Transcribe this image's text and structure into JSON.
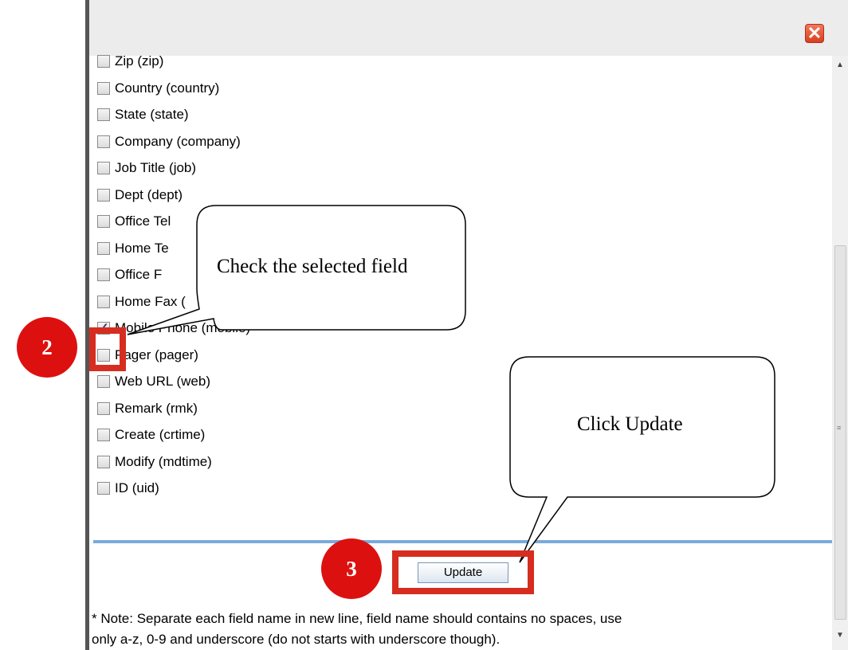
{
  "dialog": {
    "close_glyph": "✕",
    "fields": [
      {
        "label": "Zip (zip)",
        "checked": false
      },
      {
        "label": "Country (country)",
        "checked": false
      },
      {
        "label": "State (state)",
        "checked": false
      },
      {
        "label": "Company (company)",
        "checked": false
      },
      {
        "label": "Job Title (job)",
        "checked": false
      },
      {
        "label": "Dept (dept)",
        "checked": false
      },
      {
        "label": "Office Tel",
        "checked": false
      },
      {
        "label": "Home Te",
        "checked": false
      },
      {
        "label": "Office F",
        "checked": false
      },
      {
        "label": "Home Fax (",
        "checked": false
      },
      {
        "label": "Mobile Phone (mobile)",
        "checked": true
      },
      {
        "label": "Pager (pager)",
        "checked": false
      },
      {
        "label": "Web URL (web)",
        "checked": false
      },
      {
        "label": "Remark (rmk)",
        "checked": false
      },
      {
        "label": "Create (crtime)",
        "checked": false
      },
      {
        "label": "Modify (mdtime)",
        "checked": false
      },
      {
        "label": "ID (uid)",
        "checked": false
      }
    ],
    "update_label": "Update",
    "note_line1": "* Note: Separate each field name in new line, field name should contains no spaces, use",
    "note_line2": "only a-z, 0-9 and underscore (do not starts with underscore though)."
  },
  "annotations": {
    "step2_number": "2",
    "step3_number": "3",
    "callout_check": "Check the selected field",
    "callout_update": "Click Update",
    "highlight_color": "#d62d20",
    "circle_color": "#dd1010"
  }
}
